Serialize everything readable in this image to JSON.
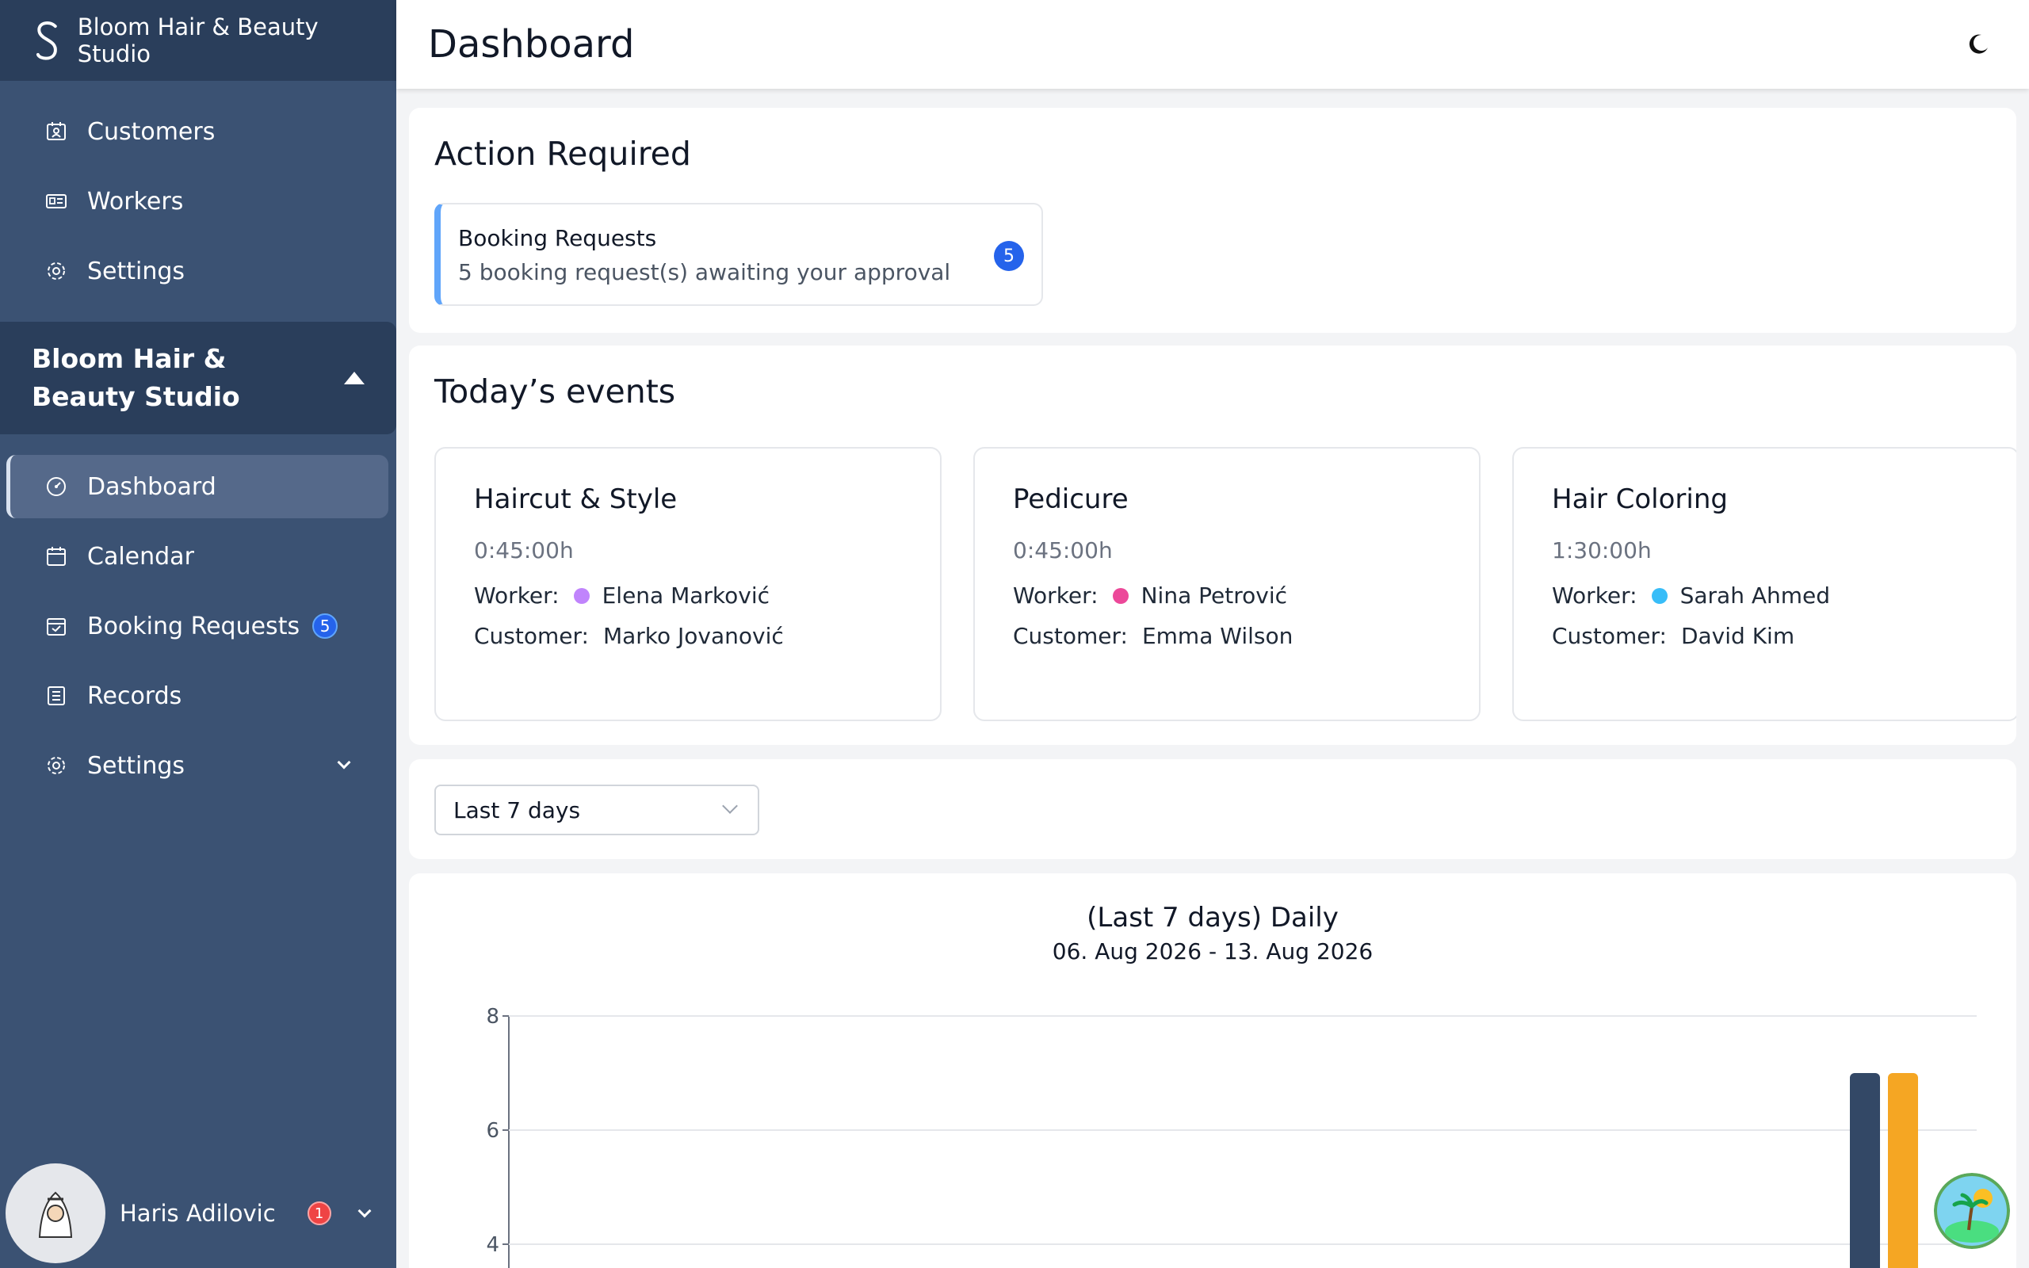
{
  "brand": {
    "name": "Bloom Hair & Beauty Studio"
  },
  "sidebar": {
    "top_items": [
      {
        "label": "Customers",
        "icon": "customers-icon"
      },
      {
        "label": "Workers",
        "icon": "id-card-icon"
      },
      {
        "label": "Settings",
        "icon": "gear-icon"
      }
    ],
    "section_title": "Bloom Hair & Beauty Studio",
    "items": [
      {
        "label": "Dashboard",
        "icon": "dashboard-icon",
        "active": true
      },
      {
        "label": "Calendar",
        "icon": "calendar-icon"
      },
      {
        "label": "Booking Requests",
        "icon": "booking-calendar-icon",
        "badge": "5"
      },
      {
        "label": "Records",
        "icon": "records-icon"
      },
      {
        "label": "Settings",
        "icon": "gear-icon"
      }
    ]
  },
  "user": {
    "name": "Haris Adilovic",
    "notifications": "1"
  },
  "header": {
    "title": "Dashboard"
  },
  "action_required": {
    "title": "Action Required",
    "request_title": "Booking Requests",
    "request_desc": "5 booking request(s) awaiting your approval",
    "request_count": "5"
  },
  "events": {
    "title": "Today’s events",
    "worker_label": "Worker:",
    "customer_label": "Customer:",
    "items": [
      {
        "title": "Haircut & Style",
        "duration": "0:45:00h",
        "worker": "Elena Marković",
        "worker_color": "#c084fc",
        "customer": "Marko Jovanović"
      },
      {
        "title": "Pedicure",
        "duration": "0:45:00h",
        "worker": "Nina Petrović",
        "worker_color": "#ec4899",
        "customer": "Emma Wilson"
      },
      {
        "title": "Hair Coloring",
        "duration": "1:30:00h",
        "worker": "Sarah Ahmed",
        "worker_color": "#38bdf8",
        "customer": "David Kim"
      }
    ]
  },
  "filter": {
    "selected": "Last 7 days"
  },
  "chart_data": {
    "type": "bar",
    "title": "(Last 7 days) Daily",
    "subtitle": "06. Aug 2026   -   13. Aug 2026",
    "y_ticks": [
      "8",
      "6",
      "4"
    ],
    "ylim": [
      4,
      8
    ],
    "series": [
      {
        "color": "#334866",
        "values": [
          7
        ]
      },
      {
        "color": "#f5a623",
        "values": [
          7
        ]
      }
    ]
  },
  "colors": {
    "sidebar": "#3b5273",
    "sidebar_dark": "#2a3e5b",
    "accent": "#2563eb"
  }
}
